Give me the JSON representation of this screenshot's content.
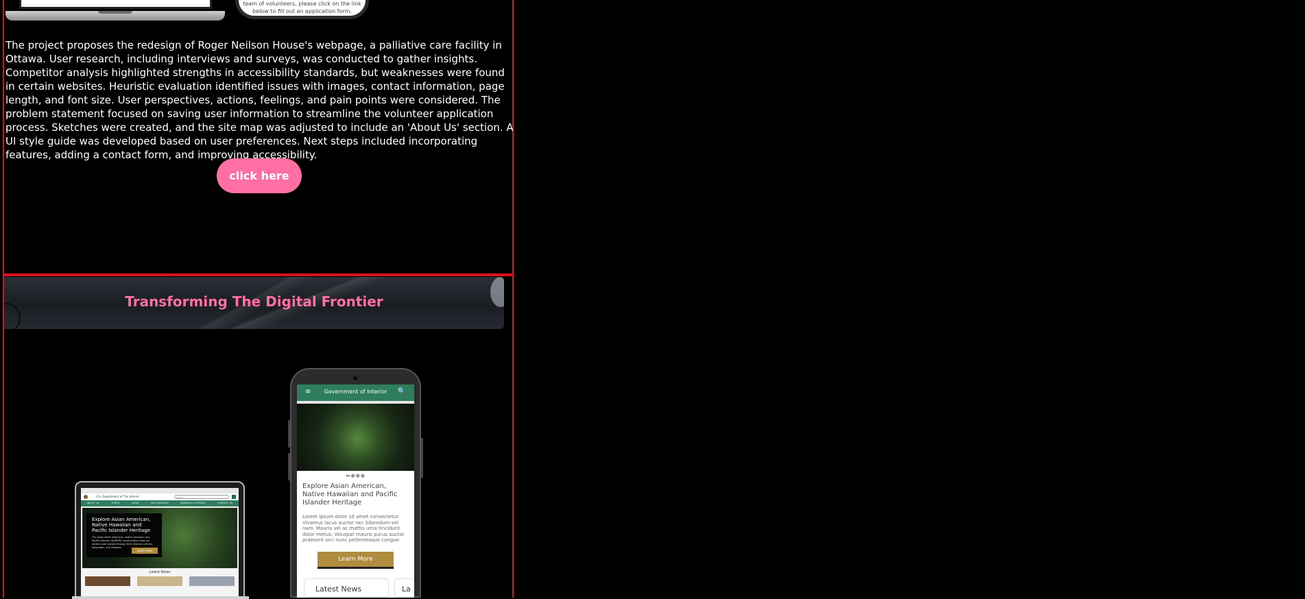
{
  "section1": {
    "phone_top_text": "team of volunteers, please click on the link below to fill out an application form.",
    "description": "The project proposes the redesign of Roger Neilson House's webpage, a palliative care facility in Ottawa. User research, including interviews and surveys, was conducted to gather insights. Competitor analysis highlighted strengths in accessibility standards, but weaknesses were found in certain websites. Heuristic evaluation identified issues with images, contact information, page length, and font size. User perspectives, actions, feelings, and pain points were considered. The problem statement focused on saving user information to streamline the volunteer application process. Sketches were created, and the site map was adjusted to include an 'About Us' section. A UI style guide was developed based on user preferences. Next steps included incorporating features, adding a contact form, and improving accessibility.",
    "cta_label": "click here"
  },
  "section2": {
    "banner_title": "Transforming The Digital Frontier",
    "laptop": {
      "header_title": "U.S. Department of The Interior",
      "search_placeholder": "Search",
      "nav_items": [
        "ABOUT US",
        "TOPICS",
        "NEWS",
        "GET INVOLVED",
        "BUREAUS & OFFICES",
        "CONTACT US"
      ],
      "hero_title": "Explore Asian American, Native Hawaiian and Pacific Islander Heritage",
      "hero_body": "The Asian North American, Native Hawaiian and Pacific Islander (AANHPI) communities make our nation more vibrant through their diverse cultures, languages, and religions.",
      "hero_button": "Learn more",
      "latest_news": "Latest News"
    },
    "phone": {
      "menu_icon": "≡",
      "header_title": "Government of Interior",
      "search_icon": "🔍",
      "carousel_dots": "▬●●●",
      "hero_title": "Explore Asian American, Native Hawaiian and Pacific Islander Heritage",
      "hero_body": "Lorem ipsum dolor sit amet consectetur. Vivamus lacus auctor nec bibendum vel nam. Mauris vel ac mattis urna tincidunt dolor metus. Volutpat mauris purus auctor praesent orci nunc pellentesque congue.",
      "learn_more": "Learn More",
      "tabs": [
        "Latest News",
        "La"
      ]
    }
  },
  "colors": {
    "background": "#000000",
    "frame_border": "#e0101c",
    "accent_pink": "#ff6fa4",
    "gov_green": "#2e7d5e",
    "gold": "#b08d3e"
  }
}
